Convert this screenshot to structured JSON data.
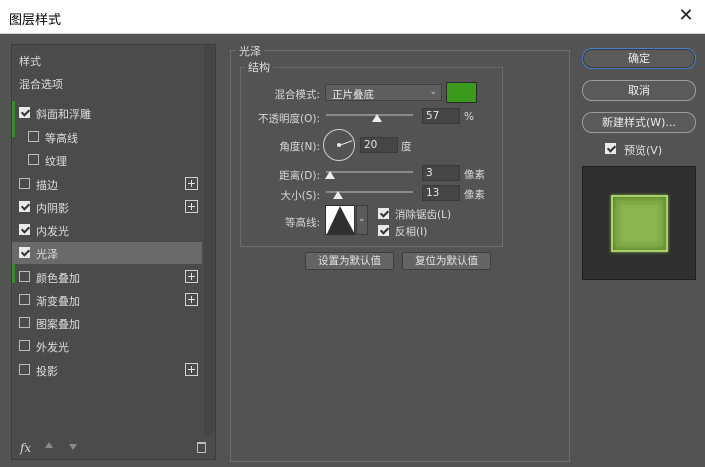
{
  "window": {
    "title": "图层样式",
    "close_icon": "close-icon"
  },
  "sidebar": {
    "header": "样式",
    "blend_options": "混合选项",
    "items": [
      {
        "label": "斜面和浮雕",
        "checked": true,
        "plus": false,
        "indent": false
      },
      {
        "label": "等高线",
        "checked": false,
        "plus": false,
        "indent": true
      },
      {
        "label": "纹理",
        "checked": false,
        "plus": false,
        "indent": true
      },
      {
        "label": "描边",
        "checked": false,
        "plus": true,
        "indent": false
      },
      {
        "label": "内阴影",
        "checked": true,
        "plus": true,
        "indent": false
      },
      {
        "label": "内发光",
        "checked": true,
        "plus": false,
        "indent": false
      },
      {
        "label": "光泽",
        "checked": true,
        "plus": false,
        "indent": false,
        "selected": true
      },
      {
        "label": "颜色叠加",
        "checked": false,
        "plus": true,
        "indent": false
      },
      {
        "label": "渐变叠加",
        "checked": false,
        "plus": true,
        "indent": false
      },
      {
        "label": "图案叠加",
        "checked": false,
        "plus": false,
        "indent": false
      },
      {
        "label": "外发光",
        "checked": false,
        "plus": false,
        "indent": false
      },
      {
        "label": "投影",
        "checked": false,
        "plus": true,
        "indent": false
      }
    ],
    "fx_label": "fx"
  },
  "satin": {
    "group_title": "光泽",
    "structure_title": "结构",
    "blend_mode_label": "混合模式:",
    "blend_mode_value": "正片叠底",
    "color": "#3a9a1c",
    "opacity_label": "不透明度(O):",
    "opacity_value": "57",
    "opacity_unit": "%",
    "angle_label": "角度(N):",
    "angle_value": "20",
    "angle_unit": "度",
    "distance_label": "距离(D):",
    "distance_value": "3",
    "distance_unit": "像素",
    "size_label": "大小(S):",
    "size_value": "13",
    "size_unit": "像素",
    "contour_label": "等高线:",
    "anti_alias_label": "消除锯齿(L)",
    "anti_alias_checked": true,
    "invert_label": "反相(I)",
    "invert_checked": true,
    "set_default_label": "设置为默认值",
    "reset_default_label": "复位为默认值"
  },
  "actions": {
    "ok_label": "确定",
    "cancel_label": "取消",
    "new_style_label": "新建样式(W)...",
    "preview_label": "预览(V)",
    "preview_checked": true
  },
  "colors": {
    "accent_green": "#3a8d2e",
    "preview_fill": "#87b04c"
  }
}
